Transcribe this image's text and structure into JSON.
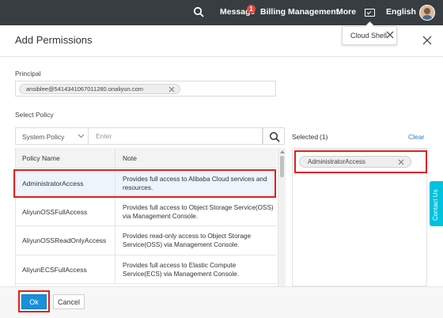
{
  "topbar": {
    "message_label": "Message",
    "message_badge": "1",
    "billing_label": "Billing Management",
    "more_label": "More",
    "language_label": "English",
    "icons": [
      "search-icon",
      "cloud-shell-icon",
      "avatar"
    ]
  },
  "tooltip": {
    "label": "Cloud Shell"
  },
  "panel": {
    "title": "Add Permissions",
    "principal_label": "Principal",
    "principal_value": "ansiblee@5414341067011280.onaliyun.com",
    "select_policy_label": "Select Policy",
    "policy_type": "System Policy",
    "search_placeholder": "Enter"
  },
  "table": {
    "headers": [
      "Policy Name",
      "Note"
    ],
    "rows": [
      {
        "name": "AdministratorAccess",
        "note": "Provides full access to Alibaba Cloud services and resources."
      },
      {
        "name": "AliyunOSSFullAccess",
        "note": "Provides full access to Object Storage Service(OSS) via Management Console."
      },
      {
        "name": "AliyunOSSReadOnlyAccess",
        "note": "Provides read-only access to Object Storage Service(OSS) via Management Console."
      },
      {
        "name": "AliyunECSFullAccess",
        "note": "Provides full access to Elastic Compute Service(ECS) via Management Console."
      }
    ]
  },
  "selected": {
    "label": "Selected",
    "count": "(1)",
    "clear_label": "Clear",
    "items": [
      "AdministratorAccess"
    ]
  },
  "side_tab": {
    "label": "Contact Us"
  },
  "footer": {
    "ok_label": "Ok",
    "cancel_label": "Cancel"
  },
  "colors": {
    "topbar": "#373d41",
    "primary": "#1a8fd8",
    "highlight": "#e02020",
    "link": "#1a7bd6",
    "contact_tab": "#00c1de"
  }
}
